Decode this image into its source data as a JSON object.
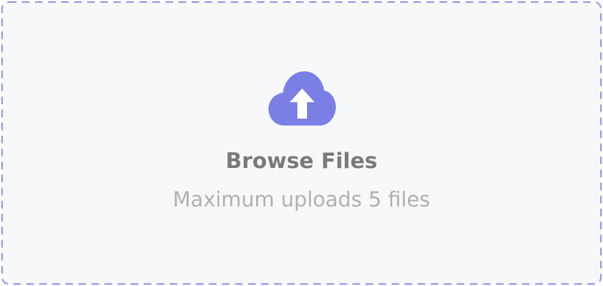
{
  "upload": {
    "title": "Browse Files",
    "subtitle": "Maximum uploads 5 files",
    "icon": "cloud-upload-icon"
  },
  "colors": {
    "accent": "#7a7fe6",
    "border": "#8a8fe6",
    "background": "#f6f8fa",
    "title_text": "#7a7a7a",
    "subtitle_text": "#b0b0b0"
  }
}
